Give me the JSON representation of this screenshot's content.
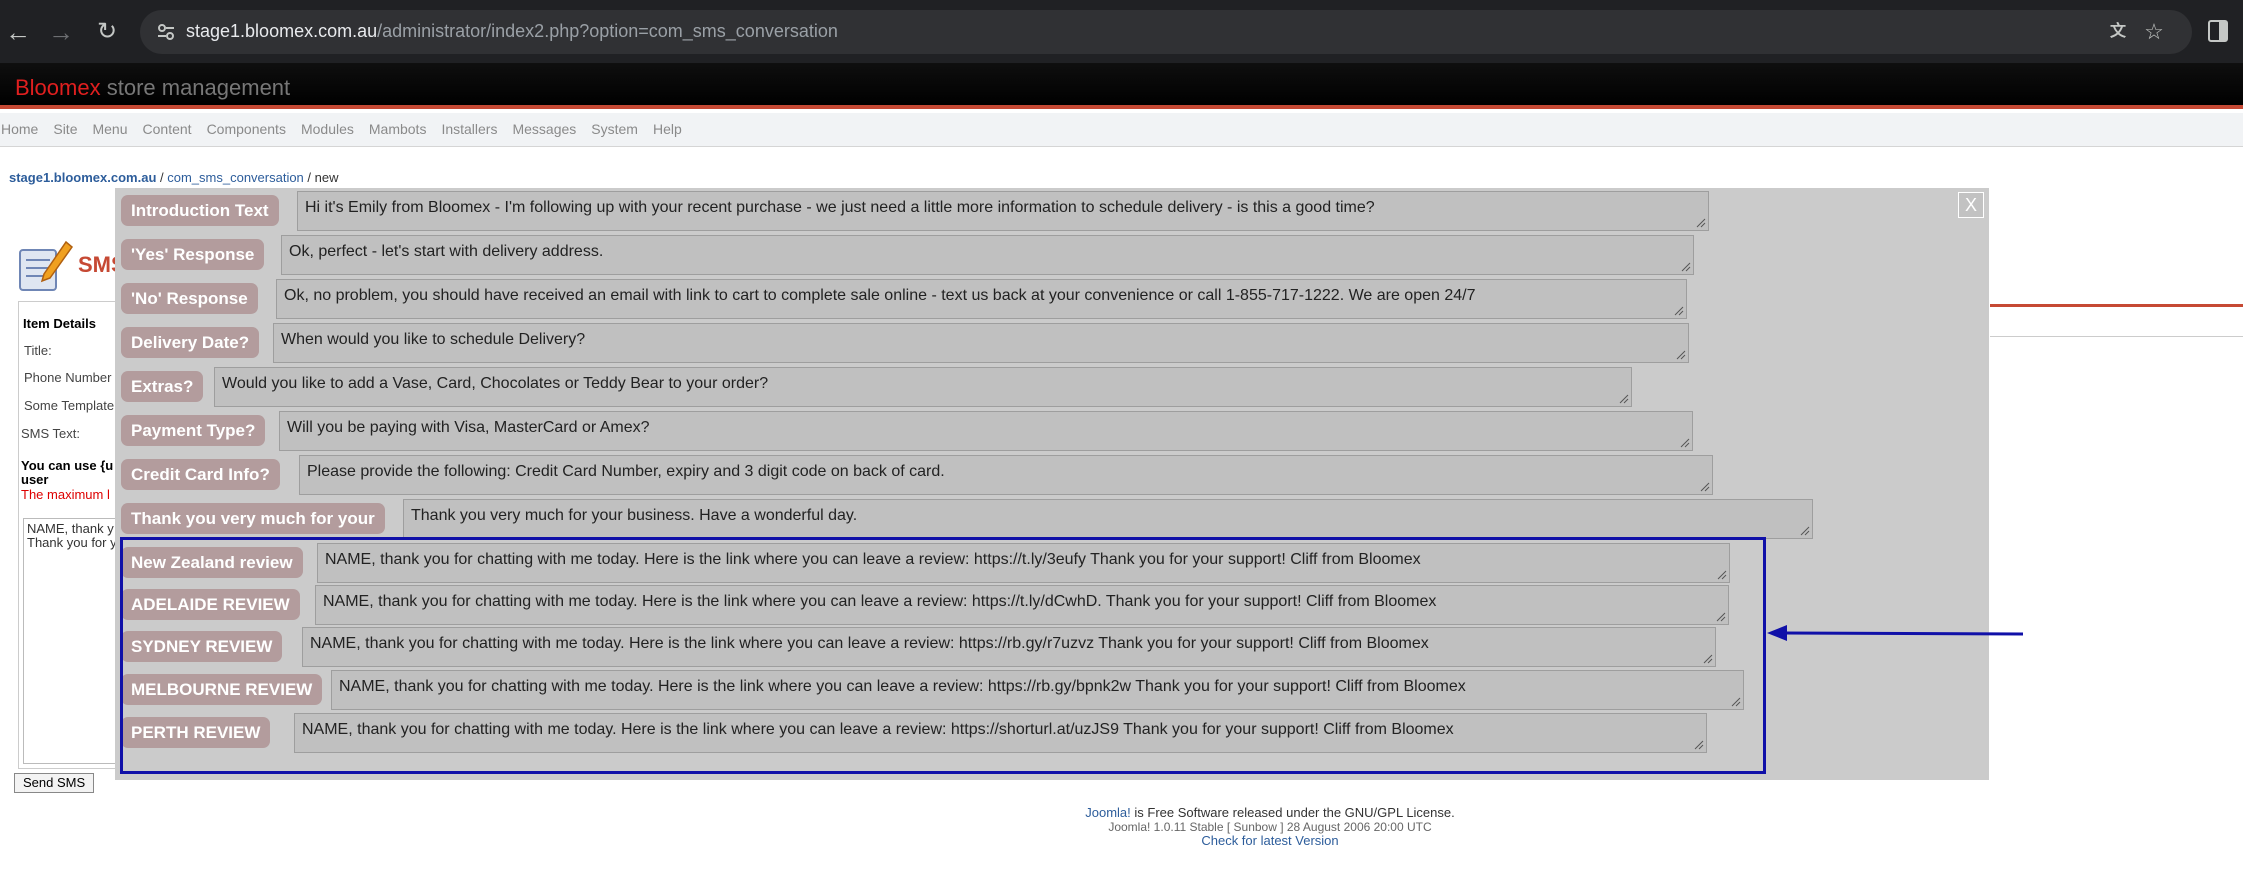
{
  "browser": {
    "url_host": "stage1.bloomex.com.au",
    "url_path": "/administrator/index2.php?option=com_sms_conversation",
    "icons": [
      "back-icon",
      "forward-icon",
      "reload-icon",
      "site-settings-icon",
      "translate-icon",
      "bookmark-star-icon",
      "side-panel-icon"
    ]
  },
  "header": {
    "brand_primary": "Bloomex",
    "brand_secondary": "store management",
    "menu": [
      "Home",
      "Site",
      "Menu",
      "Content",
      "Components",
      "Modules",
      "Mambots",
      "Installers",
      "Messages",
      "System",
      "Help"
    ]
  },
  "pathway": {
    "host": "stage1.bloomex.com.au",
    "sep1": " / ",
    "component": "com_sms_conversation",
    "sep2": " / new"
  },
  "background_form": {
    "title_fragment": "SMS",
    "item_details": "Item Details",
    "title_label": "Title:",
    "phone_label": "Phone Number",
    "template_label": "Some Template",
    "sms_text_label": "SMS Text:",
    "hint_line1": "You can use {u",
    "hint_line2": "user",
    "max_hint": "The maximum l",
    "preview_line1": "NAME, thank y",
    "preview_line2": "Thank you for y",
    "send_button": "Send SMS"
  },
  "modal": {
    "close_label": "X",
    "templates": [
      {
        "label": "Introduction Text",
        "text": "Hi it's Emily from Bloomex - I'm following up with your recent purchase - we just need a little more information to schedule delivery - is this a good time?"
      },
      {
        "label": "'Yes' Response",
        "text": "Ok, perfect - let's start with delivery address."
      },
      {
        "label": "'No' Response",
        "text": "Ok, no problem, you should have received an email with link to cart to complete sale online - text us back at your convenience or call 1-855-717-1222. We are open 24/7"
      },
      {
        "label": "Delivery Date?",
        "text": "When would you like to schedule Delivery?"
      },
      {
        "label": "Extras?",
        "text": "Would you like to add a Vase, Card, Chocolates or Teddy Bear to your order?"
      },
      {
        "label": "Payment Type?",
        "text": "Will you be paying with Visa, MasterCard or Amex?"
      },
      {
        "label": "Credit  Card Info?",
        "text": "Please provide the following: Credit Card Number, expiry and 3 digit code on back of card."
      },
      {
        "label": "Thank you very much for your",
        "text": "Thank you very much for your business. Have a wonderful day."
      },
      {
        "label": "New Zealand review",
        "text": "NAME, thank you for chatting with me today. Here is the link where you can leave a review: https://t.ly/3eufy Thank you for your support! Cliff from Bloomex"
      },
      {
        "label": "ADELAIDE REVIEW",
        "text": "NAME, thank you for chatting with me today. Here is the link where you can leave a review: https://t.ly/dCwhD. Thank you for your support! Cliff from Bloomex"
      },
      {
        "label": "SYDNEY REVIEW",
        "text": "NAME, thank you for chatting with me today. Here is the link where you can leave a review: https://rb.gy/r7uzvz Thank you for your support! Cliff from Bloomex"
      },
      {
        "label": "MELBOURNE REVIEW",
        "text": "NAME, thank you for chatting with me today. Here is the link where you can leave a review: https://rb.gy/bpnk2w Thank you for your support! Cliff from Bloomex"
      },
      {
        "label": "PERTH REVIEW",
        "text": "NAME, thank you for chatting with me today. Here is the link where you can leave a review: https://shorturl.at/uzJS9 Thank you for your support! Cliff from Bloomex"
      }
    ]
  },
  "footer": {
    "joomla_link": "Joomla!",
    "license_text": " is Free Software released under the GNU/GPL License.",
    "version": "Joomla! 1.0.11 Stable [ Sunbow ] 28 August 2006 20:00 UTC",
    "check_link": "Check for latest Version"
  },
  "colors": {
    "header_accent": "#c64934",
    "tag_bg": "#b39c9d",
    "highlight_border": "#1010a8"
  }
}
